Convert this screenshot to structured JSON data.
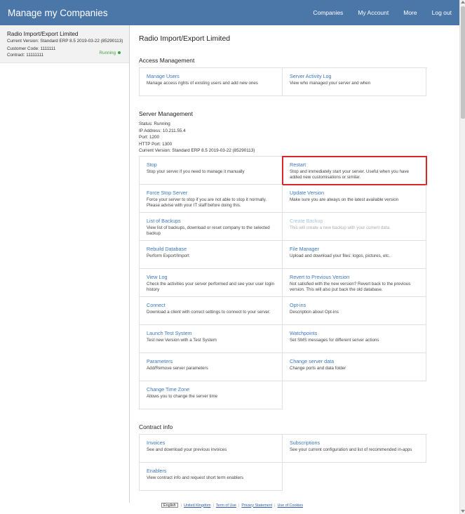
{
  "topbar": {
    "brand": "Manage my Companies",
    "nav": [
      "Companies",
      "My Account",
      "More",
      "Log out"
    ]
  },
  "sidebar": {
    "company_name": "Radio Import/Export Limited",
    "version": "Current Version: Standard ERP 8.5 2019-03-22 (85290113)",
    "customer_code": "Customer Code: 1111111",
    "contract": "Contract: 11111111",
    "status": "Running",
    "status_color": "#3aa63a"
  },
  "main": {
    "title": "Radio Import/Export Limited",
    "access": {
      "heading": "Access Management",
      "items": [
        {
          "title": "Manage Users",
          "desc": "Manage access rights of existing users and add new ones"
        },
        {
          "title": "Server Activity Log",
          "desc": "View who managed your server and when"
        }
      ]
    },
    "server": {
      "heading": "Server Management",
      "status": "Status: Running",
      "ip": "IP Address: 10.211.55.4",
      "port": "Port: 1200",
      "http_port": "HTTP Port: 1300",
      "version": "Current Version: Standard ERP 8.5 2019-03-22 (85290113)",
      "items": [
        {
          "title": "Stop",
          "desc": "Stop your server if you need to manage it manually"
        },
        {
          "title": "Restart",
          "desc": "Stop and immediately start your server. Useful when you have added new customisations or similar."
        },
        {
          "title": "Force Stop Server",
          "desc": "Force your server to stop if you are not able to stop it normally. Please advise with your IT staff before doing this."
        },
        {
          "title": "Update Version",
          "desc": "Make sure you are always on the latest available version"
        },
        {
          "title": "List of Backups",
          "desc": "View list of backups, download or reset company to the selected backup"
        },
        {
          "title": "Create Backup",
          "desc": "This will create a new backup with your current data."
        },
        {
          "title": "Rebuild Database",
          "desc": "Perform Export/Import"
        },
        {
          "title": "File Manager",
          "desc": "Upload and download your files: logos, pictures, etc."
        },
        {
          "title": "View Log",
          "desc": "Check the activities your server performed and see your user login history"
        },
        {
          "title": "Revert to Previous Version",
          "desc": "Not satisfied with the new version? Revert back to the previous version. This will also put back the old database."
        },
        {
          "title": "Connect",
          "desc": "Download a client with correct settings to connect to your server."
        },
        {
          "title": "Opt-ins",
          "desc": "Description about Opt-ins"
        },
        {
          "title": "Launch Test System",
          "desc": "Test new Version with a Test System"
        },
        {
          "title": "Watchpoints",
          "desc": "Set SMS messages for different server actions"
        },
        {
          "title": "Parameters",
          "desc": "Add/Remove server parameters"
        },
        {
          "title": "Change server data",
          "desc": "Change ports and data folder"
        },
        {
          "title": "Change Time Zone",
          "desc": "Allows you to change the server time"
        }
      ]
    },
    "contract": {
      "heading": "Contract info",
      "items": [
        {
          "title": "Invoices",
          "desc": "See and download your previous invoices"
        },
        {
          "title": "Subscriptions",
          "desc": "See your current configuration and list of recommended in-apps"
        },
        {
          "title": "Enablers",
          "desc": "View contract info and request short term enablers"
        }
      ]
    }
  },
  "footer": {
    "language": "English",
    "links": [
      "United Kingdom",
      "Term of Use",
      "Privacy Statement",
      "Use of Cookies"
    ]
  },
  "colors": {
    "topbar": "#4a76a8",
    "link": "#3a78c2",
    "highlight_border": "#d9272e"
  }
}
